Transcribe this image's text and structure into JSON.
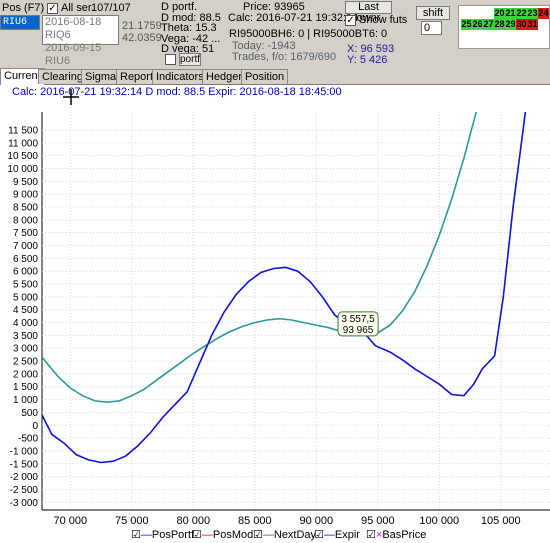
{
  "toolbar": {
    "pos_label": "Pos (F7)",
    "all_ser_label": "All ser.",
    "all_ser_checked": true,
    "count": "107/107",
    "instrument": "RIU6",
    "expirations": [
      "2016-08-18 RIQ6",
      "2016-09-15 RIU6"
    ],
    "iv_values": [
      "21.1759",
      "42.0359"
    ],
    "d_portf_label": "D portf.",
    "d_mod": "D mod: 88.5",
    "theta": "Theta: 15.3",
    "vega": "Vega: -42 ...",
    "d_vega": "D vega: 51",
    "portf_label": "portf",
    "price": "Price: 93965",
    "calc_time": "Calc: 2016-07-21 19:32:14",
    "ri_line": "RI95000BH6: 0 | RI95000BT6: 0",
    "today": "Today: -1943",
    "trades": "Trades, f/o: 1679/690",
    "last_own_label": "Last ownr",
    "show_futs_label": "Show futs",
    "show_futs_checked": true,
    "x_coord": "X: 96 593",
    "y_coord": "Y: 5 426",
    "shift_label": "shift",
    "shift_value": "0",
    "days_grid": [
      {
        "v": "20",
        "c": "g"
      },
      {
        "v": "21",
        "c": "g"
      },
      {
        "v": "22",
        "c": "g"
      },
      {
        "v": "23",
        "c": "g"
      },
      {
        "v": "24",
        "c": "r"
      },
      {
        "v": "25",
        "c": "g"
      },
      {
        "v": "26",
        "c": "g"
      },
      {
        "v": "27",
        "c": "g"
      },
      {
        "v": "28",
        "c": "g"
      },
      {
        "v": "29",
        "c": "g"
      },
      {
        "v": "30",
        "c": "r"
      },
      {
        "v": "31",
        "c": "r"
      }
    ]
  },
  "tabs": [
    "Current",
    "Clearing",
    "Sigma",
    "Report",
    "Indicators",
    "Hedger",
    "Position"
  ],
  "active_tab": "Current",
  "chart_header": "Calc: 2016-07-21 19:32:14  D mod: 88.5  Expir: 2016-08-18 18:45:00",
  "tooltip": {
    "line1": "3 557,5",
    "line2": "93 965"
  },
  "legend": [
    {
      "label": "PosPortf",
      "color": "#0000ff"
    },
    {
      "label": "PosMod",
      "color": "#ff0000"
    },
    {
      "label": "NextDay",
      "color": "#008000"
    },
    {
      "label": "Expir",
      "color": "#0000ff"
    },
    {
      "label": "BasPrice",
      "color": "#ff00ff"
    }
  ],
  "chart_data": {
    "type": "line",
    "x_ticks": [
      "70 000",
      "75 000",
      "80 000",
      "85 000",
      "90 000",
      "95 000",
      "100 000",
      "105 000"
    ],
    "x_tick_values": [
      70000,
      75000,
      80000,
      85000,
      90000,
      95000,
      100000,
      105000
    ],
    "y_ticks": [
      "11 500",
      "11 000",
      "10 500",
      "10 000",
      "9 500",
      "9 000",
      "8 500",
      "8 000",
      "7 500",
      "7 000",
      "6 500",
      "6 000",
      "5 500",
      "5 000",
      "4 500",
      "4 000",
      "3 500",
      "3 000",
      "2 500",
      "2 000",
      "1 500",
      "1 000",
      "500",
      "0",
      "-500",
      "-1 000",
      "-1 500",
      "-2 000",
      "-2 500",
      "-3 000"
    ],
    "y_tick_values": [
      11500,
      11000,
      10500,
      10000,
      9500,
      9000,
      8500,
      8000,
      7500,
      7000,
      6500,
      6000,
      5500,
      5000,
      4500,
      4000,
      3500,
      3000,
      2500,
      2000,
      1500,
      1000,
      500,
      0,
      -500,
      -1000,
      -1500,
      -2000,
      -2500,
      -3000
    ],
    "xlim": [
      67700,
      109000
    ],
    "ylim": [
      -3300,
      12200
    ],
    "grid": true,
    "series": [
      {
        "name": "NextDay",
        "color": "#2a9a9a",
        "x": [
          67700,
          69000,
          70000,
          71000,
          72000,
          73000,
          74000,
          75000,
          76000,
          77000,
          78000,
          79000,
          80000,
          81000,
          82000,
          83000,
          84000,
          85000,
          86000,
          87000,
          88000,
          89000,
          90000,
          91000,
          92000,
          93000,
          94000,
          95000,
          96000,
          97000,
          98000,
          99000,
          100000,
          101000,
          102000,
          103000,
          104000,
          105000,
          106000,
          107000
        ],
        "y": [
          2650,
          1900,
          1450,
          1150,
          950,
          900,
          950,
          1150,
          1400,
          1750,
          2100,
          2450,
          2800,
          3100,
          3400,
          3650,
          3850,
          4000,
          4100,
          4150,
          4100,
          4000,
          3900,
          3800,
          3650,
          3550,
          3500,
          3600,
          3900,
          4450,
          5200,
          6200,
          7400,
          8800,
          10400,
          12200,
          14000,
          15500,
          17000,
          18500
        ]
      },
      {
        "name": "Expir",
        "color": "#1010e0",
        "x": [
          67700,
          68500,
          69500,
          70500,
          71500,
          72500,
          73500,
          74500,
          75500,
          76500,
          77500,
          78500,
          79500,
          80500,
          81500,
          82500,
          83500,
          84500,
          85500,
          86500,
          87500,
          88500,
          89500,
          90500,
          91500,
          92500,
          93965,
          94800,
          96000,
          97000,
          98000,
          99000,
          100000,
          101000,
          102000,
          102800,
          103500,
          104500,
          105200,
          106000,
          107000,
          107800
        ],
        "y": [
          400,
          -350,
          -700,
          -1150,
          -1350,
          -1450,
          -1400,
          -1200,
          -800,
          -300,
          300,
          800,
          1300,
          2400,
          3500,
          4400,
          5100,
          5600,
          5950,
          6100,
          6150,
          6000,
          5600,
          5000,
          4300,
          3900,
          3557,
          3100,
          2850,
          2550,
          2200,
          1900,
          1600,
          1200,
          1150,
          1600,
          2200,
          2700,
          5000,
          8500,
          12200,
          14000
        ]
      }
    ]
  }
}
